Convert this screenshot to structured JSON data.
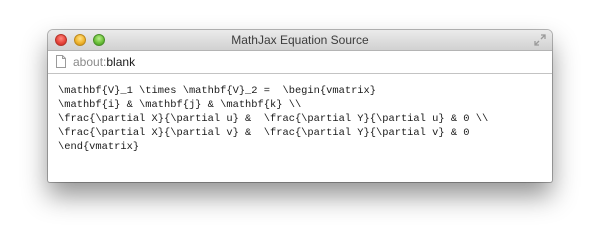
{
  "window": {
    "title": "MathJax Equation Source",
    "controls": [
      "close-button",
      "minimize-button",
      "zoom-button",
      "fullscreen-icon"
    ]
  },
  "address_bar": {
    "icon": "page-icon",
    "scheme": "about:",
    "path": "blank"
  },
  "content": {
    "lines": [
      "\\mathbf{V}_1 \\times \\mathbf{V}_2 =  \\begin{vmatrix}",
      "\\mathbf{i} & \\mathbf{j} & \\mathbf{k} \\\\",
      "\\frac{\\partial X}{\\partial u} &  \\frac{\\partial Y}{\\partial u} & 0 \\\\",
      "\\frac{\\partial X}{\\partial v} &  \\frac{\\partial Y}{\\partial v} & 0",
      "\\end{vmatrix}"
    ]
  }
}
